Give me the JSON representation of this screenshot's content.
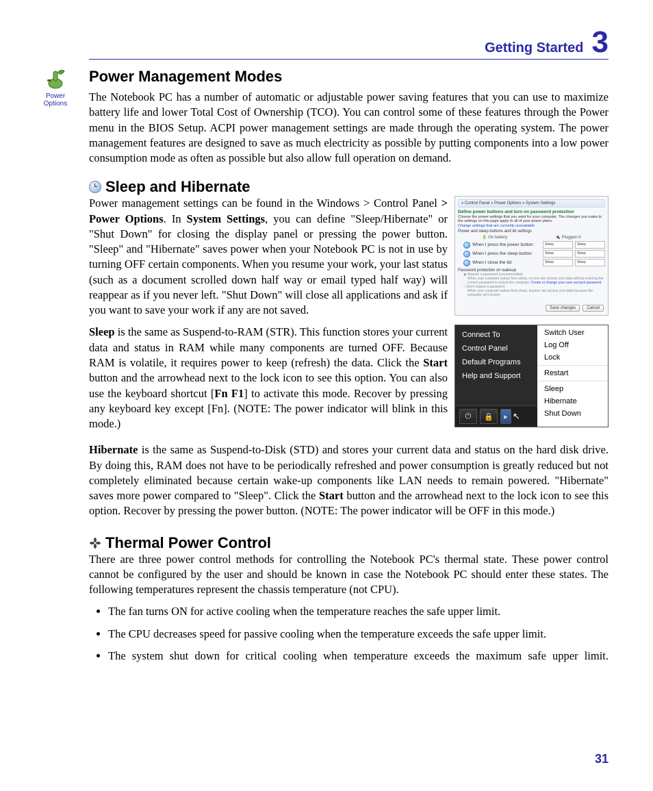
{
  "header": {
    "title": "Getting Started",
    "chapter": "3"
  },
  "left_icon": {
    "line1": "Power",
    "line2": "Options"
  },
  "s1": {
    "title": "Power Management Modes",
    "p1": "The Notebook PC has a number of automatic or adjustable power saving features that you can use to maximize battery life and lower Total Cost of Ownership (TCO). You can control some of these features through the Power menu in the BIOS Setup. ACPI power management settings are made through the operating system. The power management features are designed to save as much electricity as possible by putting components into a low power consumption mode as often as possible but also allow full operation on demand."
  },
  "s2": {
    "title": "Sleep and Hibernate",
    "p1_a": "Power management settings can be found in the Windows > Control Panel ",
    "p1_b": "> Power Options",
    "p1_c": ". In ",
    "p1_d": "System Settings",
    "p1_e": ", you can define \"Sleep/Hibernate\" or \"Shut Down\" for closing the display panel or pressing the power button. \"Sleep\" and \"Hibernate\" saves power when your Notebook PC is not in use by turning OFF certain components. When you resume your work, your last status (such as a document scrolled down half way or email typed half way) will reappear as if you never left. \"Shut Down\" will close all applications and ask if you want to save your work if any are not saved.",
    "p2_a": "Sleep",
    "p2_b": " is the same as Suspend-to-RAM (STR). This function stores your current data and status in RAM while many components are turned OFF. Because RAM is volatile, it requires power to keep (refresh) the data. Click the ",
    "p2_c": "Start",
    "p2_d": " button and the arrowhead next to the lock icon to see this option. You can also use the keyboard shortcut [",
    "p2_e": "Fn F1",
    "p2_f": "] to activate this mode. Recover by pressing any keyboard key except [Fn]. (NOTE: The power indicator will blink in this mode.)",
    "p3_a": "Hibernate",
    "p3_b": " is the same as  Suspend-to-Disk (STD) and stores your current data and status on the hard disk drive. By doing this, RAM does not have to be periodically refreshed and power consumption is greatly reduced but not completely eliminated because certain wake-up components like LAN needs to remain powered. \"Hibernate\" saves more power compared to \"Sleep\". Click the ",
    "p3_c": "Start",
    "p3_d": " button and the arrowhead next to the lock icon to see this option. Recover by pressing the power button. (NOTE: The power indicator will be OFF in this mode.)"
  },
  "cp": {
    "breadcrumb": "« Control Panel » Power Options » System Settings",
    "heading": "Define power buttons and turn on password protection",
    "sub": "Choose the power settings that you want for your computer. The changes you make to the settings on this page apply to all of your power plans.",
    "link1": "Change settings that are currently unavailable",
    "sec1": "Power and sleep buttons and lid settings",
    "col1": "On battery",
    "col2": "Plugged in",
    "r1": "When I press the power button:",
    "r2": "When I press the sleep button:",
    "r3": "When I close the lid:",
    "opt": "Sleep",
    "sec2": "Password protection on wakeup",
    "opt1": "Require a password (recommended)",
    "opt1d": "When your computer wakes from sleep, no one can access your data without entering the correct password to unlock the computer.",
    "link2": "Create or change your user account password",
    "opt2": "Don't require a password",
    "opt2d": "When your computer wakes from sleep, anyone can access your data because the computer isn't locked.",
    "btn_save": "Save changes",
    "btn_cancel": "Cancel"
  },
  "sm": {
    "left": [
      "Connect To",
      "Control Panel",
      "Default Programs",
      "Help and Support"
    ],
    "right_top": [
      "Switch User",
      "Log Off",
      "Lock"
    ],
    "right_mid": [
      "Restart"
    ],
    "right_bot": [
      "Sleep",
      "Hibernate",
      "Shut Down"
    ]
  },
  "s3": {
    "title": "Thermal Power Control",
    "p1": "There are three power control methods for controlling the Notebook PC's thermal state. These power control cannot be configured by the user and should be known in case the Notebook PC should enter these states. The following temperatures represent the chassis temperature (not CPU).",
    "b1": "The fan turns ON for active cooling when the temperature reaches the safe upper limit.",
    "b2": "The CPU decreases speed for passive cooling when the temperature exceeds the safe upper limit.",
    "b3": "The system shut down for critical cooling when temperature exceeds the maximum safe upper limit."
  },
  "page_number": "31"
}
